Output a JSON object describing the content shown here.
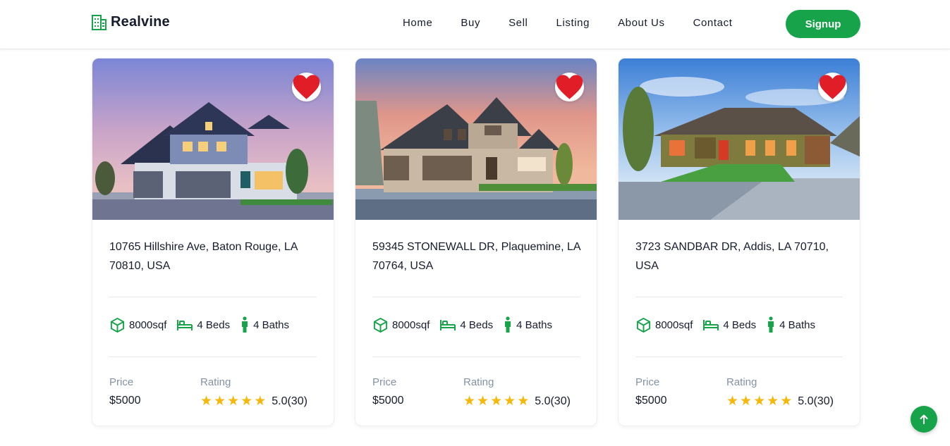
{
  "brand": {
    "name": "Realvine",
    "accent": "#16a34a"
  },
  "nav": {
    "links": [
      "Home",
      "Buy",
      "Sell",
      "Listing",
      "About Us",
      "Contact"
    ],
    "signup_label": "Signup"
  },
  "labels": {
    "price": "Price",
    "rating": "Rating"
  },
  "listings": [
    {
      "address": "10765 Hillshire Ave, Baton Rouge, LA 70810, USA",
      "area": "8000sqf",
      "beds": "4 Beds",
      "baths": "4 Baths",
      "price": "$5000",
      "stars": 5,
      "rating": "5.0(30)",
      "favorite": true
    },
    {
      "address": "59345 STONEWALL DR, Plaquemine, LA 70764, USA",
      "area": "8000sqf",
      "beds": "4 Beds",
      "baths": "4 Baths",
      "price": "$5000",
      "stars": 5,
      "rating": "5.0(30)",
      "favorite": true
    },
    {
      "address": "3723 SANDBAR DR, Addis, LA 70710, USA",
      "area": "8000sqf",
      "beds": "4 Beds",
      "baths": "4 Baths",
      "price": "$5000",
      "stars": 5,
      "rating": "5.0(30)",
      "favorite": true
    }
  ],
  "icons": {
    "logo": "building-icon",
    "favorite": "heart-icon",
    "area": "cube-icon",
    "beds": "bed-icon",
    "baths": "person-icon",
    "rating": "star-icon",
    "back_to_top": "arrow-up-icon"
  }
}
